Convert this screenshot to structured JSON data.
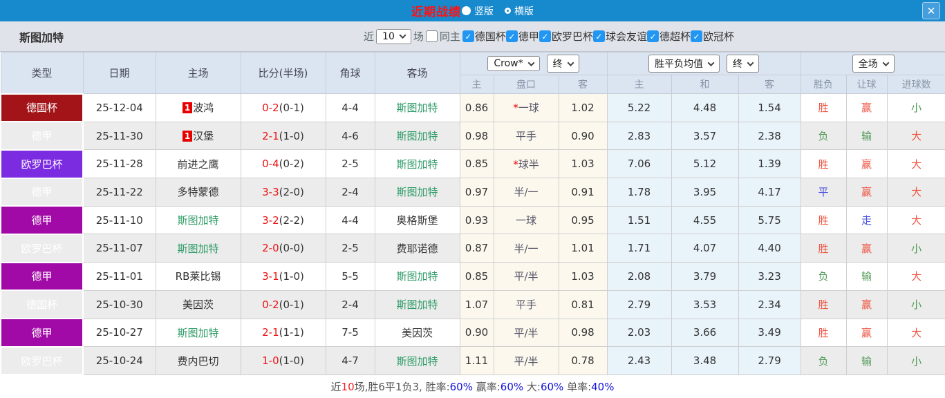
{
  "icons": {
    "close": "✕",
    "check": "✓",
    "radio_on": "filled-circle",
    "radio_off": "empty-circle"
  },
  "colors": {
    "titlebar_bg": "#1789cd",
    "title_red": "#ff1212",
    "league_cup": "#a31418",
    "league_liga": "#a10aa6",
    "league_europa": "#7b2ce0",
    "team_green": "#2e9b67",
    "score_red": "#ee1111",
    "result_red": "#ee5544",
    "result_green": "#4f9955",
    "result_blue": "#4a55dd",
    "handicap_col_bg": "#fcf8ee",
    "avg_col_bg": "#e9f3fa",
    "checkbox_blue": "#2196f3",
    "summary_blue": "#1414d8"
  },
  "titlebar": {
    "title": "近期战绩",
    "radio_vertical": "竖版",
    "radio_horizontal": "横版"
  },
  "filterbar": {
    "team": "斯图加特",
    "recent_label": "近",
    "recent_value": "10",
    "matches_label": "场",
    "same_home_label": "同主",
    "leagues": [
      "德国杯",
      "德甲",
      "欧罗巴杯",
      "球会友谊",
      "德超杯",
      "欧冠杯"
    ]
  },
  "table": {
    "main_headers": [
      "类型",
      "日期",
      "主场",
      "比分(半场)",
      "角球",
      "客场"
    ],
    "odds_select": "Crow*",
    "odds_final_select": "终",
    "avg_select": "胜平负均值",
    "avg_final_select": "终",
    "full_select": "全场",
    "sub_headers": [
      "主",
      "盘口",
      "客",
      "主",
      "和",
      "客",
      "胜负",
      "让球",
      "进球数"
    ],
    "rows": [
      {
        "league": "德国杯",
        "lk": "cup",
        "date": "25-12-04",
        "home": "波鸿",
        "home_badge": "1",
        "home_self": false,
        "score_ft": "0-2",
        "score_ht": "(0-1)",
        "corner": "4-4",
        "away": "斯图加特",
        "away_self": true,
        "ah_home": "0.86",
        "ah_star": true,
        "ah_line": "一球",
        "ah_away": "1.02",
        "avg_home": "5.22",
        "avg_draw": "4.48",
        "avg_away": "1.54",
        "res_wdl": {
          "t": "胜",
          "c": "r"
        },
        "res_ah": {
          "t": "赢",
          "c": "r"
        },
        "res_ou": {
          "t": "小",
          "c": "g"
        }
      },
      {
        "league": "德甲",
        "lk": "liga",
        "date": "25-11-30",
        "home": "汉堡",
        "home_badge": "1",
        "home_self": false,
        "score_ft": "2-1",
        "score_ht": "(1-0)",
        "corner": "4-6",
        "away": "斯图加特",
        "away_self": true,
        "ah_home": "0.98",
        "ah_star": false,
        "ah_line": "平手",
        "ah_away": "0.90",
        "avg_home": "2.83",
        "avg_draw": "3.57",
        "avg_away": "2.38",
        "res_wdl": {
          "t": "负",
          "c": "g"
        },
        "res_ah": {
          "t": "输",
          "c": "g"
        },
        "res_ou": {
          "t": "大",
          "c": "r"
        }
      },
      {
        "league": "欧罗巴杯",
        "lk": "europa",
        "date": "25-11-28",
        "home": "前进之鹰",
        "home_badge": null,
        "home_self": false,
        "score_ft": "0-4",
        "score_ht": "(0-2)",
        "corner": "2-5",
        "away": "斯图加特",
        "away_self": true,
        "ah_home": "0.85",
        "ah_star": true,
        "ah_line": "球半",
        "ah_away": "1.03",
        "avg_home": "7.06",
        "avg_draw": "5.12",
        "avg_away": "1.39",
        "res_wdl": {
          "t": "胜",
          "c": "r"
        },
        "res_ah": {
          "t": "赢",
          "c": "r"
        },
        "res_ou": {
          "t": "大",
          "c": "r"
        }
      },
      {
        "league": "德甲",
        "lk": "liga",
        "date": "25-11-22",
        "home": "多特蒙德",
        "home_badge": null,
        "home_self": false,
        "score_ft": "3-3",
        "score_ht": "(2-0)",
        "corner": "2-4",
        "away": "斯图加特",
        "away_self": true,
        "ah_home": "0.97",
        "ah_star": false,
        "ah_line": "半/一",
        "ah_away": "0.91",
        "avg_home": "1.78",
        "avg_draw": "3.95",
        "avg_away": "4.17",
        "res_wdl": {
          "t": "平",
          "c": "b"
        },
        "res_ah": {
          "t": "赢",
          "c": "r"
        },
        "res_ou": {
          "t": "大",
          "c": "r"
        }
      },
      {
        "league": "德甲",
        "lk": "liga",
        "date": "25-11-10",
        "home": "斯图加特",
        "home_badge": null,
        "home_self": true,
        "score_ft": "3-2",
        "score_ht": "(2-2)",
        "corner": "4-4",
        "away": "奥格斯堡",
        "away_self": false,
        "ah_home": "0.93",
        "ah_star": false,
        "ah_line": "一球",
        "ah_away": "0.95",
        "avg_home": "1.51",
        "avg_draw": "4.55",
        "avg_away": "5.75",
        "res_wdl": {
          "t": "胜",
          "c": "r"
        },
        "res_ah": {
          "t": "走",
          "c": "b"
        },
        "res_ou": {
          "t": "大",
          "c": "r"
        }
      },
      {
        "league": "欧罗巴杯",
        "lk": "europa",
        "date": "25-11-07",
        "home": "斯图加特",
        "home_badge": null,
        "home_self": true,
        "score_ft": "2-0",
        "score_ht": "(0-0)",
        "corner": "2-5",
        "away": "费耶诺德",
        "away_self": false,
        "ah_home": "0.87",
        "ah_star": false,
        "ah_line": "半/一",
        "ah_away": "1.01",
        "avg_home": "1.71",
        "avg_draw": "4.07",
        "avg_away": "4.40",
        "res_wdl": {
          "t": "胜",
          "c": "r"
        },
        "res_ah": {
          "t": "赢",
          "c": "r"
        },
        "res_ou": {
          "t": "小",
          "c": "g"
        }
      },
      {
        "league": "德甲",
        "lk": "liga",
        "date": "25-11-01",
        "home": "RB莱比锡",
        "home_badge": null,
        "home_self": false,
        "score_ft": "3-1",
        "score_ht": "(1-0)",
        "corner": "5-5",
        "away": "斯图加特",
        "away_self": true,
        "ah_home": "0.85",
        "ah_star": false,
        "ah_line": "平/半",
        "ah_away": "1.03",
        "avg_home": "2.08",
        "avg_draw": "3.79",
        "avg_away": "3.23",
        "res_wdl": {
          "t": "负",
          "c": "g"
        },
        "res_ah": {
          "t": "输",
          "c": "g"
        },
        "res_ou": {
          "t": "大",
          "c": "r"
        }
      },
      {
        "league": "德国杯",
        "lk": "cup",
        "date": "25-10-30",
        "home": "美因茨",
        "home_badge": null,
        "home_self": false,
        "score_ft": "0-2",
        "score_ht": "(0-1)",
        "corner": "2-4",
        "away": "斯图加特",
        "away_self": true,
        "ah_home": "1.07",
        "ah_star": false,
        "ah_line": "平手",
        "ah_away": "0.81",
        "avg_home": "2.79",
        "avg_draw": "3.53",
        "avg_away": "2.34",
        "res_wdl": {
          "t": "胜",
          "c": "r"
        },
        "res_ah": {
          "t": "赢",
          "c": "r"
        },
        "res_ou": {
          "t": "小",
          "c": "g"
        }
      },
      {
        "league": "德甲",
        "lk": "liga",
        "date": "25-10-27",
        "home": "斯图加特",
        "home_badge": null,
        "home_self": true,
        "score_ft": "2-1",
        "score_ht": "(1-1)",
        "corner": "7-5",
        "away": "美因茨",
        "away_self": false,
        "ah_home": "0.90",
        "ah_star": false,
        "ah_line": "平/半",
        "ah_away": "0.98",
        "avg_home": "2.03",
        "avg_draw": "3.66",
        "avg_away": "3.49",
        "res_wdl": {
          "t": "胜",
          "c": "r"
        },
        "res_ah": {
          "t": "赢",
          "c": "r"
        },
        "res_ou": {
          "t": "大",
          "c": "r"
        }
      },
      {
        "league": "欧罗巴杯",
        "lk": "europa",
        "date": "25-10-24",
        "home": "费内巴切",
        "home_badge": null,
        "home_self": false,
        "score_ft": "1-0",
        "score_ht": "(1-0)",
        "corner": "4-7",
        "away": "斯图加特",
        "away_self": true,
        "ah_home": "1.11",
        "ah_star": false,
        "ah_line": "平/半",
        "ah_away": "0.78",
        "avg_home": "2.43",
        "avg_draw": "3.48",
        "avg_away": "2.79",
        "res_wdl": {
          "t": "负",
          "c": "g"
        },
        "res_ah": {
          "t": "输",
          "c": "g"
        },
        "res_ou": {
          "t": "小",
          "c": "g"
        }
      }
    ]
  },
  "summary": {
    "segments": [
      {
        "t": "近",
        "c": "dark"
      },
      {
        "t": "10",
        "c": "red"
      },
      {
        "t": "场,胜6平1负3, ",
        "c": "dark"
      },
      {
        "t": "胜率:",
        "c": "dark"
      },
      {
        "t": "60%",
        "c": "blue"
      },
      {
        "t": " 赢率:",
        "c": "dark"
      },
      {
        "t": "60%",
        "c": "blue"
      },
      {
        "t": " 大:",
        "c": "dark"
      },
      {
        "t": "60%",
        "c": "blue"
      },
      {
        "t": " 单率:",
        "c": "dark"
      },
      {
        "t": "40%",
        "c": "blue"
      }
    ]
  }
}
